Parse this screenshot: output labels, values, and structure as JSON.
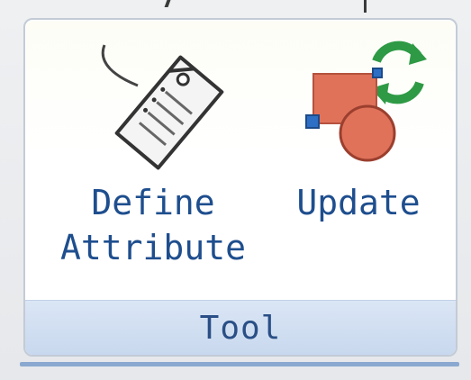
{
  "ribbon_group": {
    "label": "Tool",
    "buttons": [
      {
        "label_line1": "Define",
        "label_line2": "Attribute",
        "icon": "tag-icon"
      },
      {
        "label_line1": "Update",
        "label_line2": "",
        "icon": "update-shapes-icon"
      }
    ]
  },
  "colors": {
    "label_text": "#1e4e8e",
    "footer_bg": "#c8d8ee",
    "panel_border": "#c3cbd6",
    "shape_red": "#e0725a",
    "refresh_green": "#2e9a45"
  }
}
